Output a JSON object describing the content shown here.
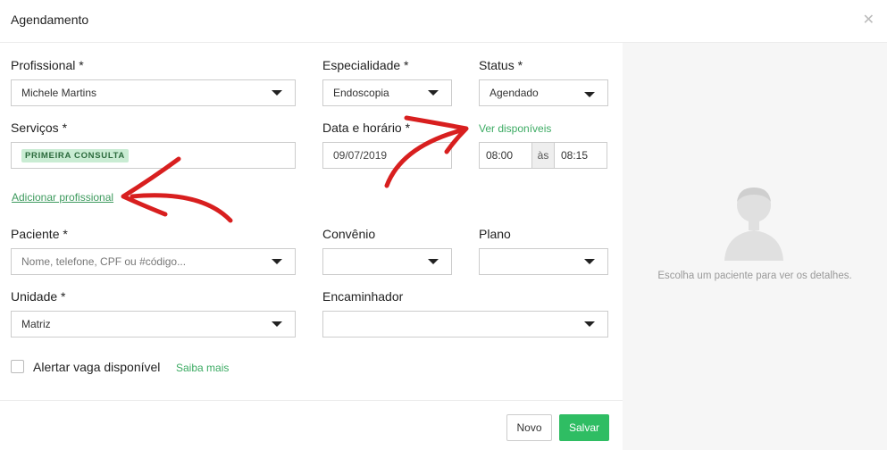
{
  "modal": {
    "title": "Agendamento",
    "close_icon": "close-icon"
  },
  "form": {
    "profissional": {
      "label": "Profissional *",
      "value": "Michele Martins"
    },
    "especialidade": {
      "label": "Especialidade *",
      "value": "Endoscopia"
    },
    "status": {
      "label": "Status *",
      "value": "Agendado"
    },
    "servicos": {
      "label": "Serviços *",
      "tag": "PRIMEIRA CONSULTA"
    },
    "data_horario": {
      "label": "Data e horário *",
      "date": "09/07/2019",
      "ver_disponiveis": "Ver disponíveis",
      "start_time": "08:00",
      "separator": "às",
      "end_time": "08:15"
    },
    "adicionar_profissional": "Adicionar profissional",
    "paciente": {
      "label": "Paciente *",
      "placeholder": "Nome, telefone, CPF ou #código..."
    },
    "convenio": {
      "label": "Convênio",
      "value": ""
    },
    "plano": {
      "label": "Plano",
      "value": ""
    },
    "unidade": {
      "label": "Unidade *",
      "value": "Matriz"
    },
    "encaminhador": {
      "label": "Encaminhador",
      "value": ""
    },
    "alertar": {
      "label": "Alertar vaga disponível",
      "checked": false,
      "saiba_mais": "Saiba mais"
    }
  },
  "side_panel": {
    "hint": "Escolha um paciente para ver os detalhes.",
    "avatar_icon": "user-placeholder-icon"
  },
  "footer": {
    "novo_label": "Novo",
    "salvar_label": "Salvar"
  },
  "colors": {
    "accent": "#2fbd63",
    "link": "#3cab63",
    "annotation_arrow": "#d81f1f"
  }
}
